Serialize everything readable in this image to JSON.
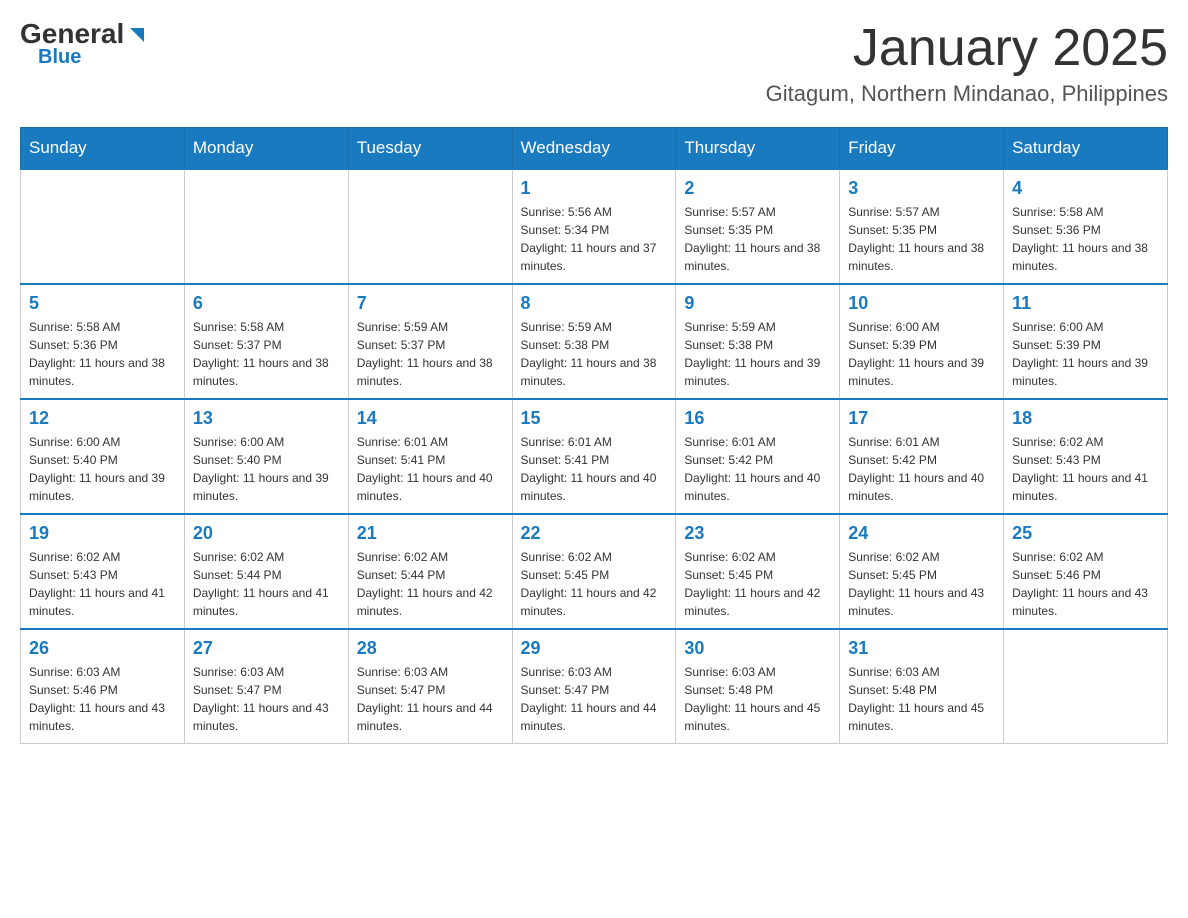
{
  "header": {
    "logo_general": "General",
    "logo_blue": "Blue",
    "month_title": "January 2025",
    "location": "Gitagum, Northern Mindanao, Philippines"
  },
  "weekdays": [
    "Sunday",
    "Monday",
    "Tuesday",
    "Wednesday",
    "Thursday",
    "Friday",
    "Saturday"
  ],
  "weeks": [
    [
      {
        "day": "",
        "info": ""
      },
      {
        "day": "",
        "info": ""
      },
      {
        "day": "",
        "info": ""
      },
      {
        "day": "1",
        "info": "Sunrise: 5:56 AM\nSunset: 5:34 PM\nDaylight: 11 hours and 37 minutes."
      },
      {
        "day": "2",
        "info": "Sunrise: 5:57 AM\nSunset: 5:35 PM\nDaylight: 11 hours and 38 minutes."
      },
      {
        "day": "3",
        "info": "Sunrise: 5:57 AM\nSunset: 5:35 PM\nDaylight: 11 hours and 38 minutes."
      },
      {
        "day": "4",
        "info": "Sunrise: 5:58 AM\nSunset: 5:36 PM\nDaylight: 11 hours and 38 minutes."
      }
    ],
    [
      {
        "day": "5",
        "info": "Sunrise: 5:58 AM\nSunset: 5:36 PM\nDaylight: 11 hours and 38 minutes."
      },
      {
        "day": "6",
        "info": "Sunrise: 5:58 AM\nSunset: 5:37 PM\nDaylight: 11 hours and 38 minutes."
      },
      {
        "day": "7",
        "info": "Sunrise: 5:59 AM\nSunset: 5:37 PM\nDaylight: 11 hours and 38 minutes."
      },
      {
        "day": "8",
        "info": "Sunrise: 5:59 AM\nSunset: 5:38 PM\nDaylight: 11 hours and 38 minutes."
      },
      {
        "day": "9",
        "info": "Sunrise: 5:59 AM\nSunset: 5:38 PM\nDaylight: 11 hours and 39 minutes."
      },
      {
        "day": "10",
        "info": "Sunrise: 6:00 AM\nSunset: 5:39 PM\nDaylight: 11 hours and 39 minutes."
      },
      {
        "day": "11",
        "info": "Sunrise: 6:00 AM\nSunset: 5:39 PM\nDaylight: 11 hours and 39 minutes."
      }
    ],
    [
      {
        "day": "12",
        "info": "Sunrise: 6:00 AM\nSunset: 5:40 PM\nDaylight: 11 hours and 39 minutes."
      },
      {
        "day": "13",
        "info": "Sunrise: 6:00 AM\nSunset: 5:40 PM\nDaylight: 11 hours and 39 minutes."
      },
      {
        "day": "14",
        "info": "Sunrise: 6:01 AM\nSunset: 5:41 PM\nDaylight: 11 hours and 40 minutes."
      },
      {
        "day": "15",
        "info": "Sunrise: 6:01 AM\nSunset: 5:41 PM\nDaylight: 11 hours and 40 minutes."
      },
      {
        "day": "16",
        "info": "Sunrise: 6:01 AM\nSunset: 5:42 PM\nDaylight: 11 hours and 40 minutes."
      },
      {
        "day": "17",
        "info": "Sunrise: 6:01 AM\nSunset: 5:42 PM\nDaylight: 11 hours and 40 minutes."
      },
      {
        "day": "18",
        "info": "Sunrise: 6:02 AM\nSunset: 5:43 PM\nDaylight: 11 hours and 41 minutes."
      }
    ],
    [
      {
        "day": "19",
        "info": "Sunrise: 6:02 AM\nSunset: 5:43 PM\nDaylight: 11 hours and 41 minutes."
      },
      {
        "day": "20",
        "info": "Sunrise: 6:02 AM\nSunset: 5:44 PM\nDaylight: 11 hours and 41 minutes."
      },
      {
        "day": "21",
        "info": "Sunrise: 6:02 AM\nSunset: 5:44 PM\nDaylight: 11 hours and 42 minutes."
      },
      {
        "day": "22",
        "info": "Sunrise: 6:02 AM\nSunset: 5:45 PM\nDaylight: 11 hours and 42 minutes."
      },
      {
        "day": "23",
        "info": "Sunrise: 6:02 AM\nSunset: 5:45 PM\nDaylight: 11 hours and 42 minutes."
      },
      {
        "day": "24",
        "info": "Sunrise: 6:02 AM\nSunset: 5:45 PM\nDaylight: 11 hours and 43 minutes."
      },
      {
        "day": "25",
        "info": "Sunrise: 6:02 AM\nSunset: 5:46 PM\nDaylight: 11 hours and 43 minutes."
      }
    ],
    [
      {
        "day": "26",
        "info": "Sunrise: 6:03 AM\nSunset: 5:46 PM\nDaylight: 11 hours and 43 minutes."
      },
      {
        "day": "27",
        "info": "Sunrise: 6:03 AM\nSunset: 5:47 PM\nDaylight: 11 hours and 43 minutes."
      },
      {
        "day": "28",
        "info": "Sunrise: 6:03 AM\nSunset: 5:47 PM\nDaylight: 11 hours and 44 minutes."
      },
      {
        "day": "29",
        "info": "Sunrise: 6:03 AM\nSunset: 5:47 PM\nDaylight: 11 hours and 44 minutes."
      },
      {
        "day": "30",
        "info": "Sunrise: 6:03 AM\nSunset: 5:48 PM\nDaylight: 11 hours and 45 minutes."
      },
      {
        "day": "31",
        "info": "Sunrise: 6:03 AM\nSunset: 5:48 PM\nDaylight: 11 hours and 45 minutes."
      },
      {
        "day": "",
        "info": ""
      }
    ]
  ]
}
